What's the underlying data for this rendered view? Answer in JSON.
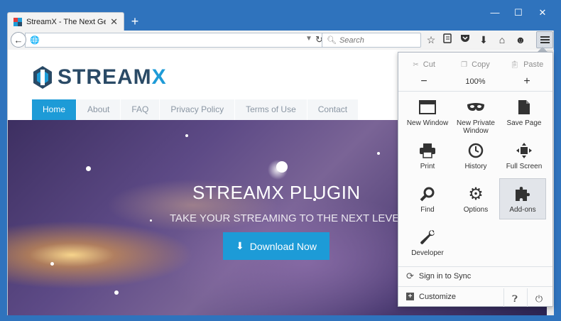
{
  "browser": {
    "tab_title": "StreamX - The Next Gener...",
    "new_tab": "+",
    "close_tab": "✕",
    "window_controls": {
      "minimize": "—",
      "maximize": "☐",
      "close": "✕"
    },
    "url": "",
    "search_placeholder": "Search"
  },
  "site": {
    "logo_text_main": "STREAM",
    "logo_text_accent": "X",
    "nav": [
      "Home",
      "About",
      "FAQ",
      "Privacy Policy",
      "Terms of Use",
      "Contact"
    ],
    "active_nav": "Home",
    "hero_title": "STREAMX PLUGIN",
    "hero_subtitle": "TAKE YOUR STREAMING TO THE NEXT LEVEL",
    "download_label": "Download Now",
    "accent_color": "#1d9bd7"
  },
  "menu": {
    "cut": "Cut",
    "copy": "Copy",
    "paste": "Paste",
    "zoom_out": "−",
    "zoom_level": "100%",
    "zoom_in": "+",
    "items": {
      "new_window": "New Window",
      "new_private_window": "New Private Window",
      "save_page": "Save Page",
      "print": "Print",
      "history": "History",
      "full_screen": "Full Screen",
      "find": "Find",
      "options": "Options",
      "addons": "Add-ons",
      "developer": "Developer"
    },
    "sign_in_sync": "Sign in to Sync",
    "customize": "Customize"
  }
}
